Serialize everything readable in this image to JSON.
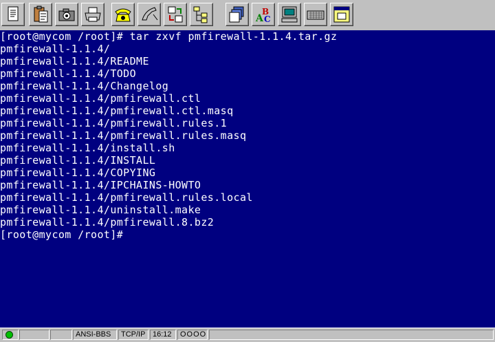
{
  "toolbar": {
    "buttons": [
      {
        "name": "new-document-icon"
      },
      {
        "name": "clipboard-paste-icon"
      },
      {
        "name": "camera-icon"
      },
      {
        "name": "printer-icon"
      },
      {
        "name": "telephone-dial-icon"
      },
      {
        "name": "hangup-icon"
      },
      {
        "name": "transfer-arrows-icon"
      },
      {
        "name": "file-tree-icon"
      },
      {
        "name": "stacked-files-icon"
      },
      {
        "name": "spellcheck-abc-icon"
      },
      {
        "name": "computer-monitor-icon"
      },
      {
        "name": "keyboard-icon"
      },
      {
        "name": "settings-window-icon"
      }
    ]
  },
  "terminal": {
    "colors": {
      "background": "#000080",
      "text": "#ffffff"
    },
    "lines": [
      "[root@mycom /root]# tar zxvf pmfirewall-1.1.4.tar.gz",
      "pmfirewall-1.1.4/",
      "pmfirewall-1.1.4/README",
      "pmfirewall-1.1.4/TODO",
      "pmfirewall-1.1.4/Changelog",
      "pmfirewall-1.1.4/pmfirewall.ctl",
      "pmfirewall-1.1.4/pmfirewall.ctl.masq",
      "pmfirewall-1.1.4/pmfirewall.rules.1",
      "pmfirewall-1.1.4/pmfirewall.rules.masq",
      "pmfirewall-1.1.4/install.sh",
      "pmfirewall-1.1.4/INSTALL",
      "pmfirewall-1.1.4/COPYING",
      "pmfirewall-1.1.4/IPCHAINS-HOWTO",
      "pmfirewall-1.1.4/pmfirewall.rules.local",
      "pmfirewall-1.1.4/uninstall.make",
      "pmfirewall-1.1.4/pmfirewall.8.bz2",
      "[root@mycom /root]#"
    ]
  },
  "statusbar": {
    "indicator_color": "#00c000",
    "terminal_type": "ANSI-BBS",
    "protocol": "TCP/IP",
    "time": "16:12",
    "leds": "OOOO"
  }
}
